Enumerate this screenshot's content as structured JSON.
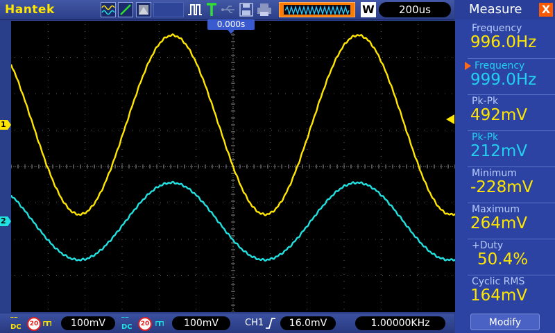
{
  "brand": "Hantek",
  "toolbar": {
    "mode_letter": "W",
    "timebase": "200us",
    "icons": [
      "waveform-display-icon",
      "vector-line-icon",
      "persist-icon",
      "pulse-icon",
      "trigger-t-icon",
      "usb-icon",
      "save-disk-icon",
      "print-icon"
    ]
  },
  "trigger": {
    "position_label": "0.000s",
    "source": "CH1",
    "edge": "rising",
    "level": "16.0mV"
  },
  "channels": [
    {
      "marker": "1",
      "coupling": "DC",
      "bandwidth": "20",
      "scale": "100mV",
      "color": "#ffe600"
    },
    {
      "marker": "2",
      "coupling": "DC",
      "bandwidth": "20",
      "scale": "100mV",
      "color": "#22e0e0"
    }
  ],
  "frequency_counter": "1.00000KHz",
  "panel": {
    "title": "Measure",
    "close_label": "X",
    "measurements": [
      {
        "label": "Frequency",
        "value": "996.0Hz",
        "channel": 1
      },
      {
        "label": "Frequency",
        "value": "999.0Hz",
        "channel": 2
      },
      {
        "label": "Pk-Pk",
        "value": "492mV",
        "channel": 1
      },
      {
        "label": "Pk-Pk",
        "value": "212mV",
        "channel": 2
      },
      {
        "label": "Minimum",
        "value": "-228mV",
        "channel": 1
      },
      {
        "label": "Maximum",
        "value": "264mV",
        "channel": 1
      },
      {
        "label": "+Duty",
        "value": "50.4%",
        "channel": 1
      },
      {
        "label": "Cyclic RMS",
        "value": "164mV",
        "channel": 1
      }
    ],
    "modify_label": "Modify"
  },
  "waveforms": {
    "ch1": {
      "frequency_hz": 996,
      "vpp_mv": 492,
      "min_mv": -228,
      "max_mv": 264
    },
    "ch2": {
      "frequency_hz": 999,
      "vpp_mv": 212
    }
  },
  "colors": {
    "ch1": "#ffe600",
    "ch2": "#22e0e0",
    "accent": "#ff5a00",
    "panel": "#2c43a3"
  }
}
